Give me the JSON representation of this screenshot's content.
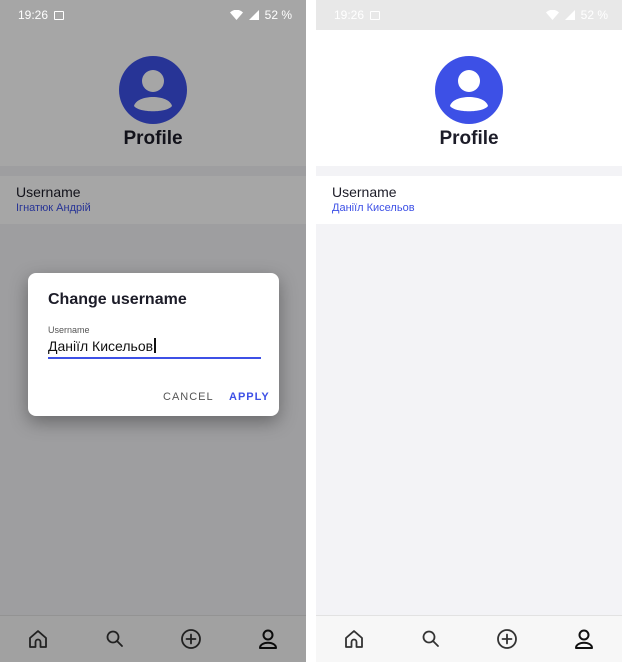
{
  "colors": {
    "accent": "#3d50e6",
    "title": "#1c1c28"
  },
  "left": {
    "status": {
      "time": "19:26",
      "battery": "52 %"
    },
    "profile": {
      "title": "Profile",
      "icon": "person-avatar-icon"
    },
    "user": {
      "label": "Username",
      "value": "Ігнатюк Андрій"
    },
    "dialog": {
      "title": "Change username",
      "field_label": "Username",
      "field_value": "Даніїл Кисельов",
      "cancel_label": "CANCEL",
      "apply_label": "APPLY"
    },
    "nav": [
      "home-icon",
      "search-icon",
      "add-icon",
      "profile-icon"
    ]
  },
  "right": {
    "status": {
      "time": "19:26",
      "battery": "52 %"
    },
    "profile": {
      "title": "Profile",
      "icon": "person-avatar-icon"
    },
    "user": {
      "label": "Username",
      "value": "Даніїл Кисельов"
    },
    "nav": [
      "home-icon",
      "search-icon",
      "add-icon",
      "profile-icon"
    ]
  }
}
